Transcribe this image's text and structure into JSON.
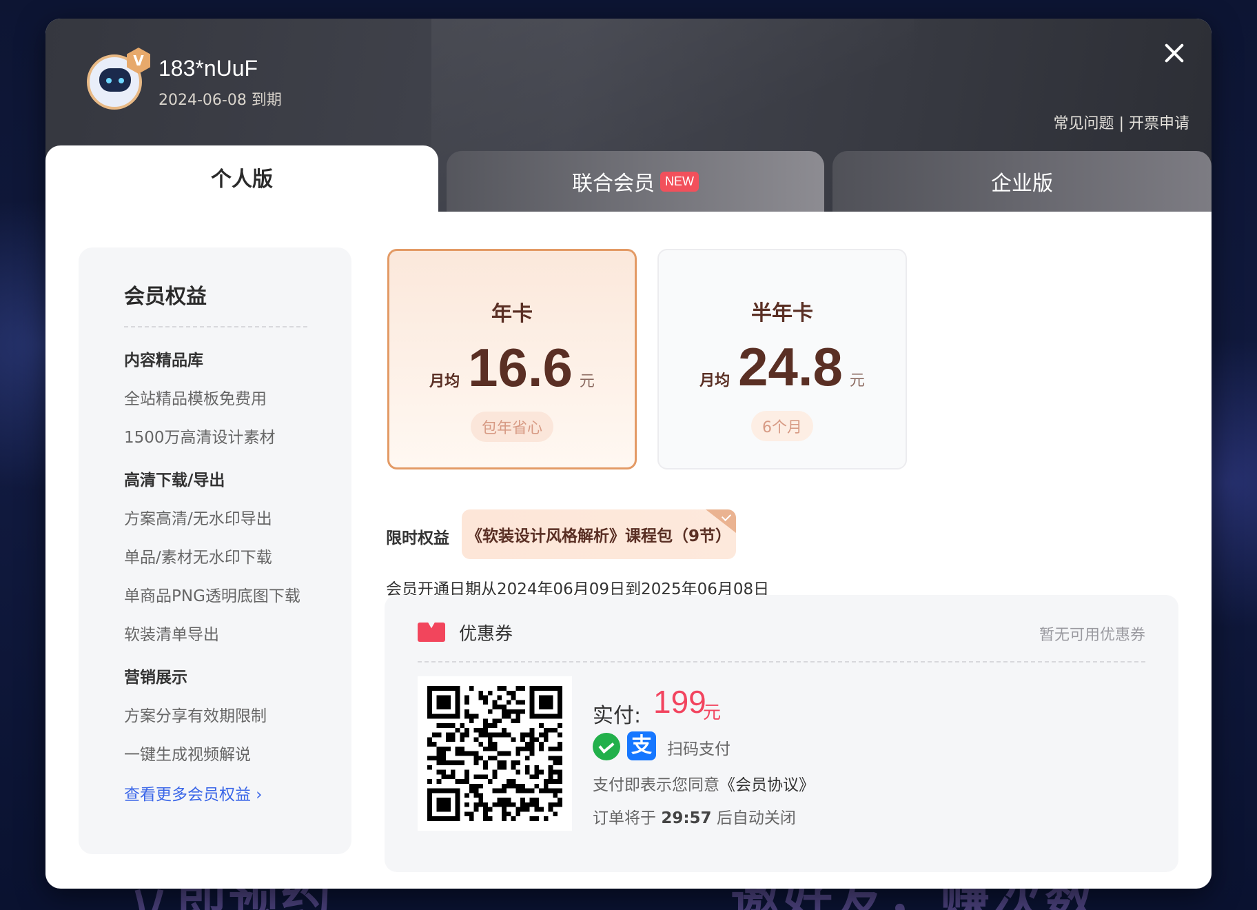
{
  "background": {
    "text_left": "立即预约",
    "text_right": "邀好友，赚次数"
  },
  "header": {
    "username": "183*nUuF",
    "expire_date": "2024-06-08",
    "expire_suffix": "到期",
    "vip_badge": "V",
    "link_faq": "常见问题",
    "link_sep": "|",
    "link_invoice": "开票申请"
  },
  "tabs": {
    "personal": "个人版",
    "joint": "联合会员",
    "joint_badge": "NEW",
    "enterprise": "企业版"
  },
  "benefits": {
    "title": "会员权益",
    "sections": [
      {
        "title": "内容精品库",
        "items": [
          "全站精品模板免费用",
          "1500万高清设计素材"
        ]
      },
      {
        "title": "高清下载/导出",
        "items": [
          "方案高清/无水印导出",
          "单品/素材无水印下载",
          "单商品PNG透明底图下载",
          "软装清单导出"
        ]
      },
      {
        "title": "营销展示",
        "items": [
          "方案分享有效期限制",
          "一键生成视频解说"
        ]
      }
    ],
    "more_link": "查看更多会员权益 ›"
  },
  "plans": [
    {
      "title": "年卡",
      "monthly_label": "月均",
      "price": "16.6",
      "unit": "元",
      "tag": "包年省心",
      "selected": true
    },
    {
      "title": "半年卡",
      "monthly_label": "月均",
      "price": "24.8",
      "unit": "元",
      "tag": "6个月",
      "selected": false
    }
  ],
  "bonus": {
    "label": "限时权益",
    "text": "《软装设计风格解析》课程包（9节）"
  },
  "period_text": "会员开通日期从2024年06月09日到2025年06月08日",
  "payment": {
    "coupon_label": "优惠券",
    "coupon_status": "暂无可用优惠券",
    "paid_label": "实付:",
    "amount": "199",
    "unit": "元",
    "scan_text": "扫码支付",
    "alipay_glyph": "支",
    "agree_prefix": "支付即表示您同意",
    "agreement": "《会员协议》",
    "order_prefix": "订单将于",
    "countdown": "29:57",
    "order_suffix": "后自动关闭"
  },
  "colors": {
    "accent_orange": "#e39a65",
    "price_red": "#f2445f",
    "link_blue": "#3a66e8",
    "new_badge": "#f2505b"
  }
}
